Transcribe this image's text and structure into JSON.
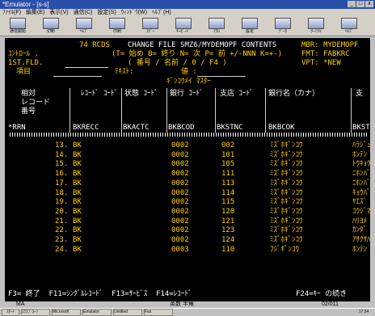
{
  "window": {
    "title": "*Emulator - [s-s]",
    "controls": [
      "_",
      "□",
      "x"
    ]
  },
  "menu": [
    "ﾌｧｲﾙ(F)",
    "編集(E)",
    "表示(V)",
    "通信(C)",
    "設定(S)",
    "ｳｨﾝﾄﾞｳ(W)",
    "ﾍﾙﾌﾟ(H)"
  ],
  "toolbar": [
    "通信開始",
    "切断",
    "ﾍﾙﾌﾟ",
    "印刷",
    "ｺﾋﾟｰ",
    "ｷｰﾎﾞｰﾄﾞ",
    "ﾏｸﾛ",
    "設定",
    "ﾃﾞｰﾀ",
    "ﾀｰﾐﾅﾙ",
    "ﾍﾙﾌﾟ"
  ],
  "screen": {
    "line1": {
      "records": "74 RCDS",
      "title": "CHANGE FILE SMZ6/MYDEMOPF CONTENTS",
      "mbr": "MBR: MYDEMOPF"
    },
    "line2": {
      "label": "ｺﾝﾄﾛｰﾙ .",
      "commands": "(T= 始め B= 終り N= 次 P= 前 +/-NNN K=+-)",
      "fmt": "FMT: FABKRC"
    },
    "line3": {
      "label": "1ST.FLD.",
      "hint": "( 番号 / 名前 / 0 / F4 )",
      "vpt": "VPT: *NEW"
    },
    "line4": {
      "label": "項目",
      "text_label": "ﾃｷｽﾄ:",
      "value_label": "値 :"
    },
    "master_title": "ｷﾞﾝｺｳﾒｲ ﾏｽﾀｰ",
    "headers": [
      "相対\nレコード\n番号",
      "ﾚｺｰﾄﾞ ｺｰﾄﾞ",
      "状態 ｺｰﾄﾞ",
      "銀行 ｺｰﾄﾞ",
      "支店 ｺｰﾄﾞ",
      "銀行名（カナ）",
      "支"
    ],
    "field_names": [
      "*RRN",
      "BKRECC",
      "BKACTC",
      "BKBCOD",
      "BKSTNC",
      "BKBCOK",
      "BKSTN"
    ],
    "rows": [
      {
        "rrn": "13.",
        "rec": "BK",
        "bank": "0002",
        "branch": "002",
        "name": "ﾐｽﾞﾎｷﾞﾝｺｳ",
        "br": "ﾊﾗｼﾞｭ"
      },
      {
        "rrn": "14.",
        "rec": "BK",
        "bank": "0002",
        "branch": "101",
        "name": "ﾐｽﾞﾎｷﾞﾝｺｳ",
        "br": "ﾎﾝﾃﾝ"
      },
      {
        "rrn": "15.",
        "rec": "BK",
        "bank": "0002",
        "branch": "105",
        "name": "ﾐｽﾞﾎｷﾞﾝｺｳ",
        "br": "ﾄｳｷｮｳ"
      },
      {
        "rrn": "16.",
        "rec": "BK",
        "bank": "0002",
        "branch": "111",
        "name": "ﾐｽﾞﾎｷﾞﾝｺｳ",
        "br": "ﾆﾎﾝﾊﾞ"
      },
      {
        "rrn": "17.",
        "rec": "BK",
        "bank": "0002",
        "branch": "113",
        "name": "ﾐｽﾞﾎｷﾞﾝｺｳ",
        "br": "ﾆﾎﾝﾊﾞ"
      },
      {
        "rrn": "18.",
        "rec": "BK",
        "bank": "0002",
        "branch": "114",
        "name": "ﾐｽﾞﾎｷﾞﾝｺｳ",
        "br": "ｷｮｳﾊﾞ"
      },
      {
        "rrn": "19.",
        "rec": "BK",
        "bank": "0002",
        "branch": "115",
        "name": "ﾐｽﾞﾎｷﾞﾝｺｳ",
        "br": "ﾔｴｽﾞ"
      },
      {
        "rrn": "20.",
        "rec": "BK",
        "bank": "0002",
        "branch": "120",
        "name": "ﾐｽﾞﾎｷﾞﾝｺｳ",
        "br": "ｺｳｼﾞﾏ"
      },
      {
        "rrn": "21.",
        "rec": "BK",
        "bank": "0002",
        "branch": "121",
        "name": "ﾐｽﾞﾎｷﾞﾝｺｳ",
        "br": "ﾊﾘﾖﾒ"
      },
      {
        "rrn": "22.",
        "rec": "BK",
        "bank": "0002",
        "branch": "123",
        "name": "ﾐｽﾞﾎｷﾞﾝｺｳ",
        "br": "ｶﾝﾀﾞ"
      },
      {
        "rrn": "23.",
        "rec": "BK",
        "bank": "0002",
        "branch": "124",
        "name": "ﾐｽﾞﾎｷﾞﾝｺｳ",
        "br": "ｱｻｸｻﾊ"
      },
      {
        "rrn": "24.",
        "rec": "BK",
        "bank": "0003",
        "branch": "110",
        "name": "ﾌｼﾞｷﾞﾝｺｳ",
        "br": "ﾎﾝﾃﾝ"
      }
    ],
    "fkeys_left": "F3= 終了  F11=ｼﾝｸﾞﾙﾚｺｰﾄﾞ  F13=ｻｰﾋﾞｽ  F14=ﾚｺｰﾄﾞ",
    "fkeys_right": "F24=ｷｰ の続き"
  },
  "status": {
    "left": "MA",
    "mode": "英数 半角",
    "position": "02/011"
  },
  "taskbar": {
    "start": "ｽﾀｰﾄ",
    "tasks": [
      "ｴｸｽﾌﾟﾛｰﾗ",
      "Microsoft",
      "Emulator",
      "Untitled",
      "Fax"
    ],
    "clock": "17:34"
  }
}
